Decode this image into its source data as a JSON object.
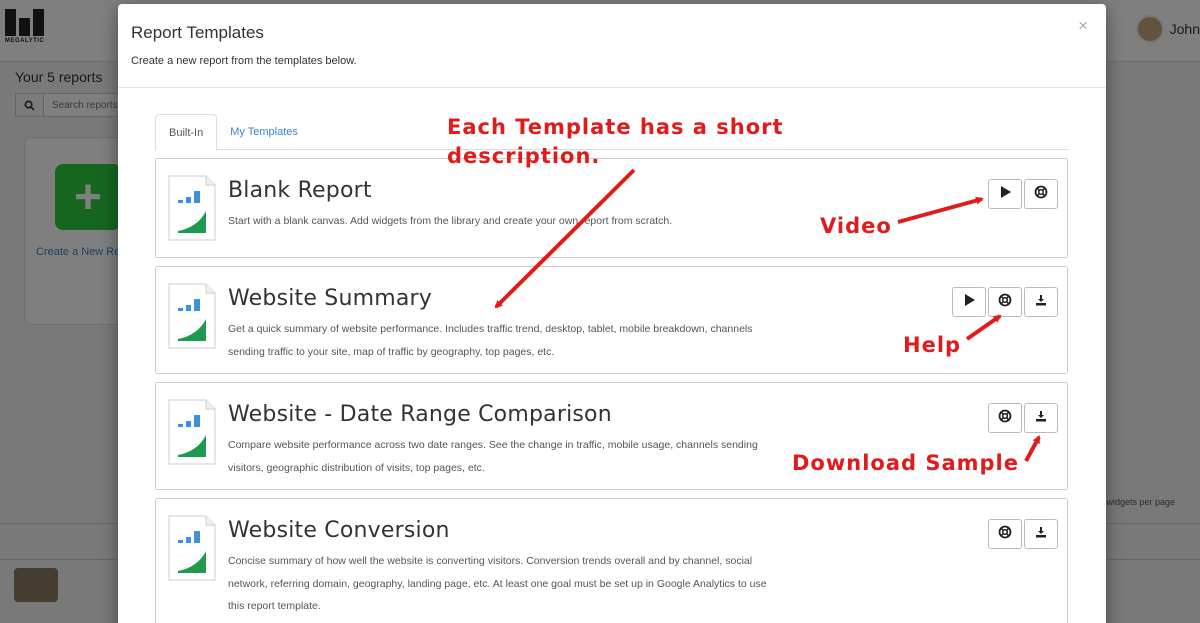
{
  "app": {
    "logo_text": "MEGALYTIC",
    "user_name": "John",
    "reports_title": "Your 5 reports",
    "search_placeholder": "Search reports",
    "new_report_label": "Create a New Report",
    "per_page_text": "widgets per page"
  },
  "modal": {
    "title": "Report Templates",
    "subtitle": "Create a new report from the templates below.",
    "close_glyph": "×",
    "tabs": [
      {
        "label": "Built-In",
        "active": true
      },
      {
        "label": "My Templates",
        "active": false
      }
    ],
    "templates": [
      {
        "name": "Blank Report",
        "description": "Start with a blank canvas. Add widgets from the library and create your own report from scratch.",
        "buttons": [
          "play-icon",
          "help-icon"
        ]
      },
      {
        "name": "Website Summary",
        "description": "Get a quick summary of website performance. Includes traffic trend, desktop, tablet, mobile breakdown, channels sending traffic to your site, map of traffic by geography, top pages, etc.",
        "buttons": [
          "play-icon",
          "help-icon",
          "download-icon"
        ]
      },
      {
        "name": "Website - Date Range Comparison",
        "description": "Compare website performance across two date ranges. See the change in traffic, mobile usage, channels sending visitors, geographic distribution of visits, top pages, etc.",
        "buttons": [
          "help-icon",
          "download-icon"
        ]
      },
      {
        "name": "Website Conversion",
        "description": "Concise summary of how well the website is converting visitors. Conversion trends overall and by channel, social network, referring domain, geography, landing page, etc. At least one goal must be set up in Google Analytics to use this report template.",
        "buttons": [
          "help-icon",
          "download-icon"
        ]
      }
    ]
  },
  "annotations": {
    "description_note_line1": "Each Template has a short",
    "description_note_line2": "description.",
    "video": "Video",
    "help": "Help",
    "download": "Download Sample",
    "color": "#e01b1b"
  },
  "colors": {
    "accent_blue": "#3a87c8",
    "chart_blue": "#3d8fe0",
    "chart_green": "#1e9a4e",
    "new_report_green": "#2ecc40"
  }
}
